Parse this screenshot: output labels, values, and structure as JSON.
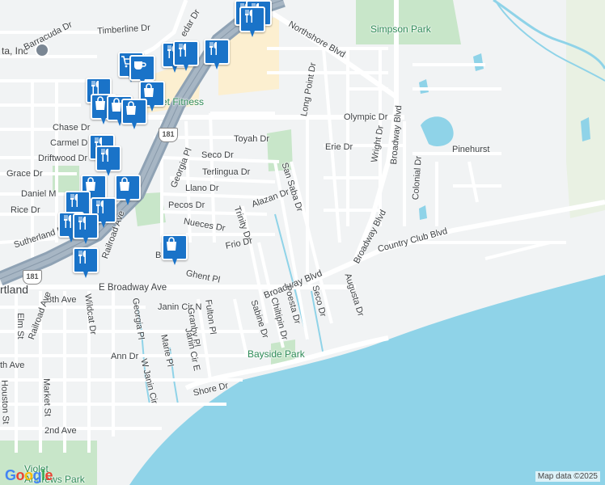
{
  "map": {
    "attribution": "Map data ©2025",
    "logo": "Google",
    "business_label": "ta, Inc",
    "fitness_label": "et Fitness",
    "parks": [
      {
        "name": "Simpson Park"
      },
      {
        "name": "Bayside Park"
      },
      {
        "name": "Violet\nAndrews Park"
      }
    ],
    "highway_shields": [
      "181",
      "181"
    ],
    "streets": {
      "timberline": "Timberline Dr",
      "barracuda": "Barracuda Dr",
      "cedar": "edar Dr",
      "northshore": "Northshore Blvd",
      "chase": "Chase Dr",
      "carmel": "Carmel D",
      "driftwood": "Driftwood Dr",
      "grace": "Grace Dr",
      "daniel": "Daniel M",
      "rice": "Rice Dr",
      "sutherland": "Sutherland Dr",
      "railroad_ave_1": "Railroad Ave",
      "railroad_ave_2": "Railroad Ave",
      "georgia_pl": "Georgia Pl",
      "seco_dr_1": "Seco Dr",
      "toyah": "Toyah Dr",
      "terlingua": "Terlingua Dr",
      "llano": "Llano Dr",
      "pecos": "Pecos Dr",
      "nueces": "Nueces Dr",
      "alazan": "Alazan Dr",
      "trinity": "Trinity Dr",
      "frio": "Frio Dr",
      "ghent": "Ghent Pl",
      "b_prefix": "B",
      "san_saba": "San Saba Dr",
      "long_point": "Long Point Dr",
      "olympic": "Olympic Dr",
      "erie": "Erie Dr",
      "wright": "Wright Dr",
      "broadway_blvd_v": "Broadway Blvd",
      "colonial": "Colonial Dr",
      "pinehurst": "Pinehurst",
      "broadway_blvd_d": "Broadway Blvd",
      "country_club": "Country Club Blvd",
      "augusta": "Augusta Dr",
      "seco_dr_2": "Seco Dr",
      "e_broadway": "E Broadway Ave",
      "broadway_blvd_s": "Broadway Blvd",
      "portland": "rtland",
      "eighth_ave": "8th Ave",
      "wildcat": "Wildcat Dr",
      "georgia_pl_2": "Georgia Pl",
      "janin_cir_n": "Janin Cir N",
      "fulton": "Fulton Pl",
      "sabine": "Sabine Dr",
      "chiltipin": "Chiltipin Dr",
      "poesta": "Poesta Dr",
      "elm": "Elm St",
      "granby": "Granby Pl",
      "janin_cir_e": "Janin Cir E",
      "marie": "Marie Pl",
      "w_janin": "W Janin Cir",
      "ann": "Ann Dr",
      "th_ave": "th Ave",
      "market": "Market St",
      "houston": "Houston St",
      "shore": "Shore Dr",
      "second_ave": "2nd Ave"
    },
    "poi_pins": [
      {
        "icon": "restaurant-icon"
      },
      {
        "icon": "restaurant-icon"
      },
      {
        "icon": "restaurant-icon"
      },
      {
        "icon": "restaurant-icon"
      },
      {
        "icon": "restaurant-icon"
      },
      {
        "icon": "restaurant-icon"
      },
      {
        "icon": "grocery-cart-icon"
      },
      {
        "icon": "coffee-icon"
      },
      {
        "icon": "shopping-bag-icon"
      },
      {
        "icon": "restaurant-icon"
      },
      {
        "icon": "shopping-bag-icon"
      },
      {
        "icon": "shopping-bag-icon"
      },
      {
        "icon": "shopping-bag-icon"
      },
      {
        "icon": "restaurant-icon"
      },
      {
        "icon": "restaurant-icon"
      },
      {
        "icon": "shopping-bag-icon"
      },
      {
        "icon": "shopping-bag-icon"
      },
      {
        "icon": "restaurant-icon"
      },
      {
        "icon": "restaurant-icon"
      },
      {
        "icon": "restaurant-icon"
      },
      {
        "icon": "restaurant-icon"
      },
      {
        "icon": "shopping-bag-icon"
      },
      {
        "icon": "restaurant-icon"
      }
    ],
    "colors": {
      "land": "#f1f3f4",
      "water": "#8fd3e8",
      "park": "#c8e6c9",
      "highway": "#8fa2b4",
      "commercial": "#fcefd0",
      "pin": "#1a73c8"
    }
  }
}
